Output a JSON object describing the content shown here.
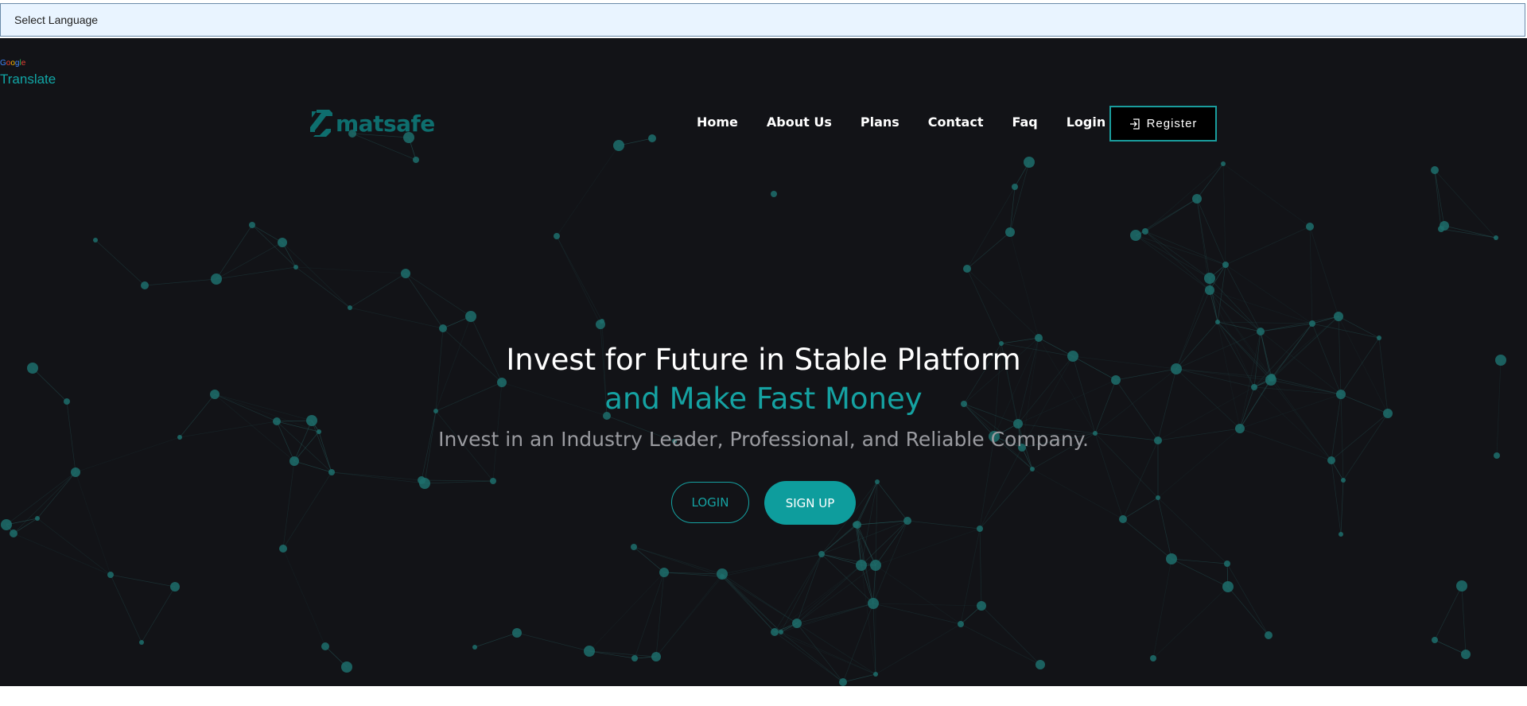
{
  "language_select": {
    "label": "Select Language"
  },
  "google_translate": {
    "brand": [
      "G",
      "o",
      "o",
      "g",
      "l",
      "e"
    ],
    "link": "Translate"
  },
  "header": {
    "logo_text": "matsafe",
    "nav": [
      "Home",
      "About Us",
      "Plans",
      "Contact",
      "Faq",
      "Login"
    ],
    "register_label": "Register"
  },
  "hero": {
    "title_line1": "Invest for Future in Stable Platform",
    "title_line2": "and Make Fast Money",
    "subtitle": "Invest in an Industry Leader, Professional, and Reliable Company.",
    "login_button": "LOGIN",
    "signup_button": "SIGN UP"
  },
  "colors": {
    "background": "#121317",
    "accent": "#15a2a2",
    "logo": "#0e6e6e",
    "select_bg": "#e9f4ff"
  },
  "icons": {
    "register": "login-icon",
    "background": "particle-network"
  }
}
